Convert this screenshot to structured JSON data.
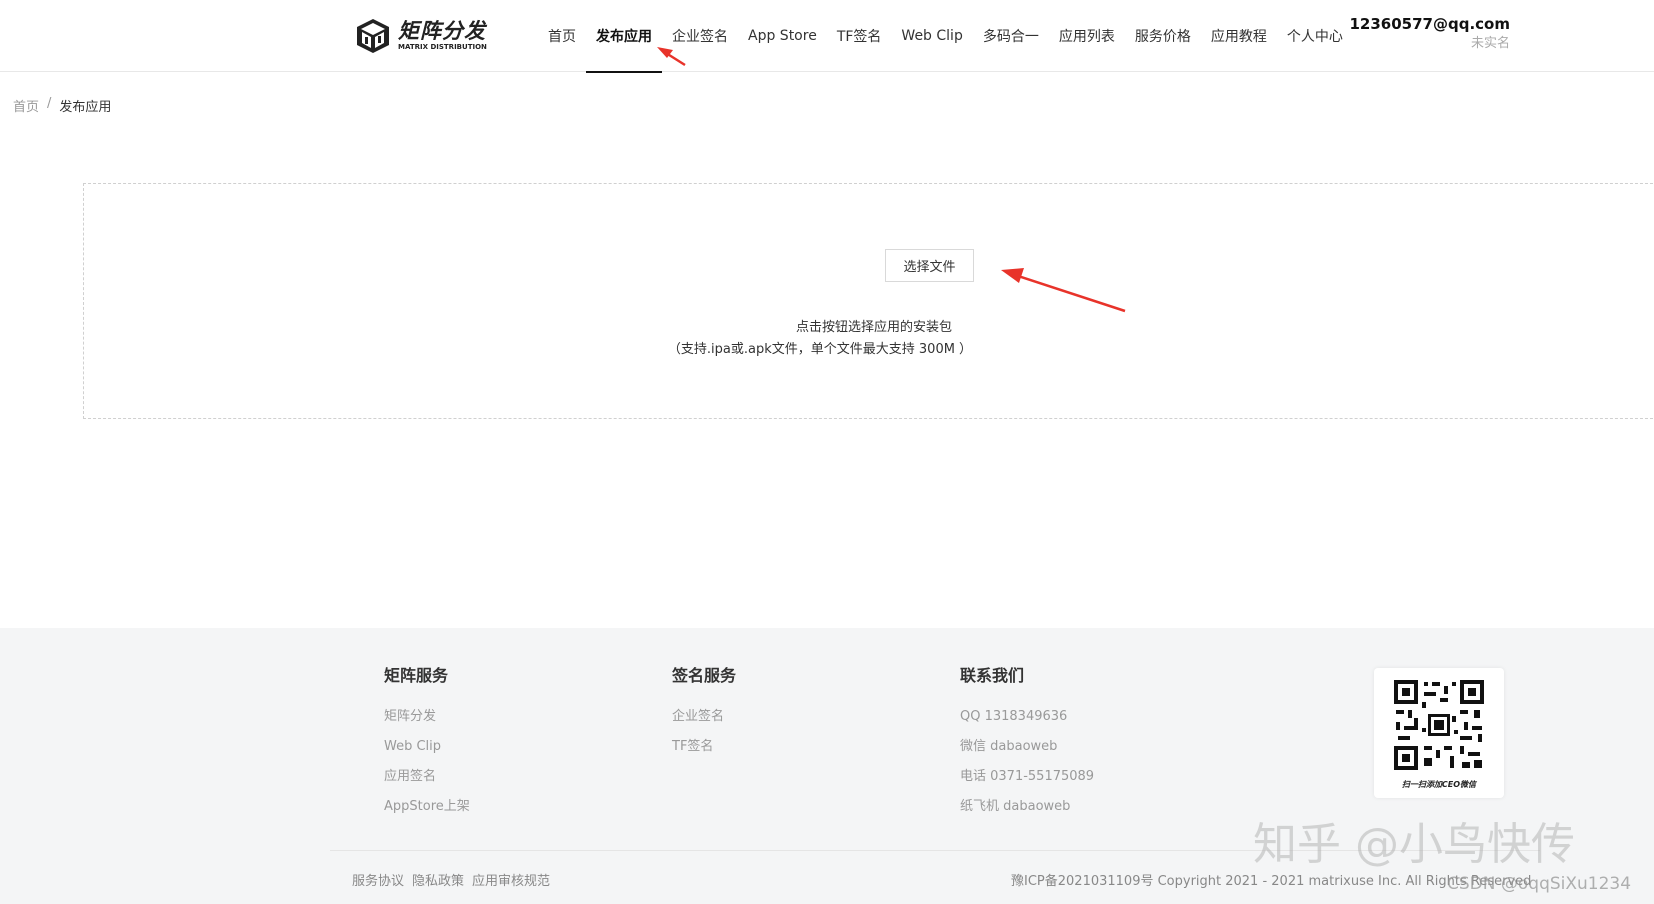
{
  "header": {
    "logo": {
      "title": "矩阵分发",
      "subtitle": "MATRIX DISTRIBUTION"
    },
    "nav": [
      {
        "label": "首页",
        "active": false
      },
      {
        "label": "发布应用",
        "active": true
      },
      {
        "label": "企业签名",
        "active": false
      },
      {
        "label": "App Store",
        "active": false
      },
      {
        "label": "TF签名",
        "active": false
      },
      {
        "label": "Web Clip",
        "active": false
      },
      {
        "label": "多码合一",
        "active": false
      },
      {
        "label": "应用列表",
        "active": false
      },
      {
        "label": "服务价格",
        "active": false
      },
      {
        "label": "应用教程",
        "active": false
      },
      {
        "label": "个人中心",
        "active": false
      }
    ],
    "user": {
      "email": "12360577@qq.com",
      "status": "未实名"
    }
  },
  "breadcrumb": {
    "home": "首页",
    "separator": "/",
    "current": "发布应用"
  },
  "upload": {
    "button_label": "选择文件",
    "hint_line1": "点击按钮选择应用的安装包",
    "hint_line2": "（支持.ipa或.apk文件，单个文件最大支持 300M ）"
  },
  "footer": {
    "columns": [
      {
        "title": "矩阵服务",
        "links": [
          "矩阵分发",
          "Web Clip",
          "应用签名",
          "AppStore上架"
        ]
      },
      {
        "title": "签名服务",
        "links": [
          "企业签名",
          "TF签名"
        ]
      },
      {
        "title": "联系我们",
        "links": [
          "QQ 1318349636",
          "微信 dabaoweb",
          "电话 0371-55175089",
          "纸飞机 dabaoweb"
        ]
      }
    ],
    "qr_caption": "扫一扫添加CEO微信",
    "bottom_links": [
      "服务协议",
      "隐私政策",
      "应用审核规范"
    ],
    "copyright": "豫ICP备2021031109号 Copyright 2021 - 2021 matrixuse Inc. All Rights Reserved"
  },
  "watermarks": {
    "zhihu": "知乎 @小鸟快传",
    "csdn": "CSDN @oqqSiXu1234"
  },
  "colors": {
    "annotation_red": "#e8332a",
    "footer_bg": "#f4f5f6",
    "active_nav": "#111111"
  }
}
